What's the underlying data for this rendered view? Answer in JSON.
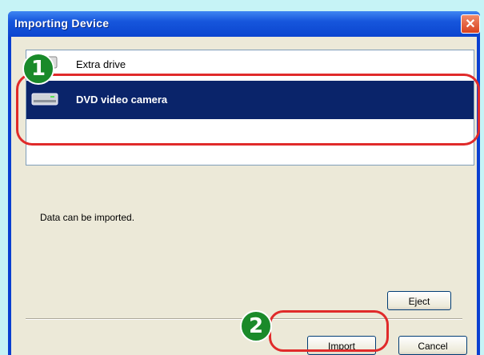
{
  "window": {
    "title": "Importing Device",
    "close_symbol": "✕"
  },
  "device_list": {
    "items": [
      {
        "label": "Extra drive",
        "icon": "drive-icon",
        "state": "partially-visible"
      },
      {
        "label": "DVD video camera",
        "icon": "dvd-camera-icon",
        "state": "selected"
      }
    ]
  },
  "status_message": "Data can be imported.",
  "buttons": {
    "eject": "Eject",
    "import": "Import",
    "cancel": "Cancel"
  },
  "annotations": {
    "step1": "1",
    "step2": "2",
    "ring_color": "#e02a2a",
    "badge_color": "#1a8a2a"
  }
}
